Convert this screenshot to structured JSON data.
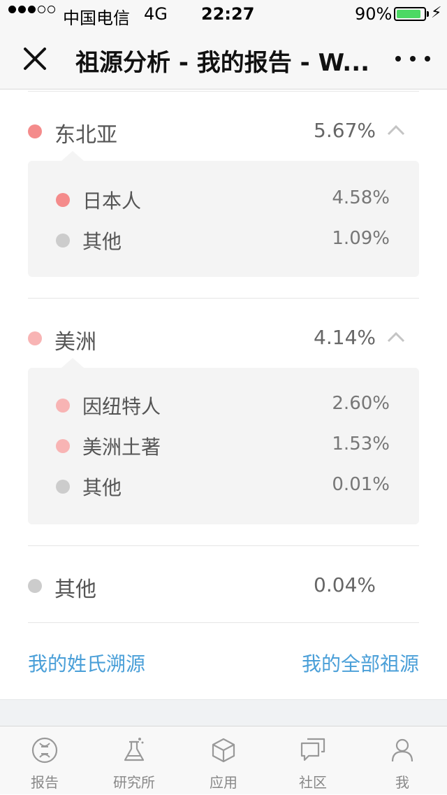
{
  "status": {
    "carrier": "中国电信",
    "network": "4G",
    "time": "22:27",
    "battery": "90%"
  },
  "nav": {
    "title": "祖源分析 - 我的报告 - W..."
  },
  "regions": [
    {
      "name": "东北亚",
      "percent": "5.67%",
      "color": "#f48b8b",
      "expanded": true,
      "children": [
        {
          "name": "日本人",
          "percent": "4.58%",
          "color": "#f48b8b"
        },
        {
          "name": "其他",
          "percent": "1.09%",
          "color": "#cccccc"
        }
      ]
    },
    {
      "name": "美洲",
      "percent": "4.14%",
      "color": "#f8b4b4",
      "expanded": true,
      "children": [
        {
          "name": "因纽特人",
          "percent": "2.60%",
          "color": "#f8b4b4"
        },
        {
          "name": "美洲土著",
          "percent": "1.53%",
          "color": "#f8b4b4"
        },
        {
          "name": "其他",
          "percent": "0.01%",
          "color": "#cccccc"
        }
      ]
    },
    {
      "name": "其他",
      "percent": "0.04%",
      "color": "#cccccc",
      "expanded": false,
      "children": []
    }
  ],
  "links": {
    "surname": "我的姓氏溯源",
    "all_ancestry": "我的全部祖源"
  },
  "tabs": [
    {
      "label": "报告",
      "icon": "dna-icon"
    },
    {
      "label": "研究所",
      "icon": "flask-icon"
    },
    {
      "label": "应用",
      "icon": "cube-icon"
    },
    {
      "label": "社区",
      "icon": "chat-icon"
    },
    {
      "label": "我",
      "icon": "person-icon"
    }
  ]
}
